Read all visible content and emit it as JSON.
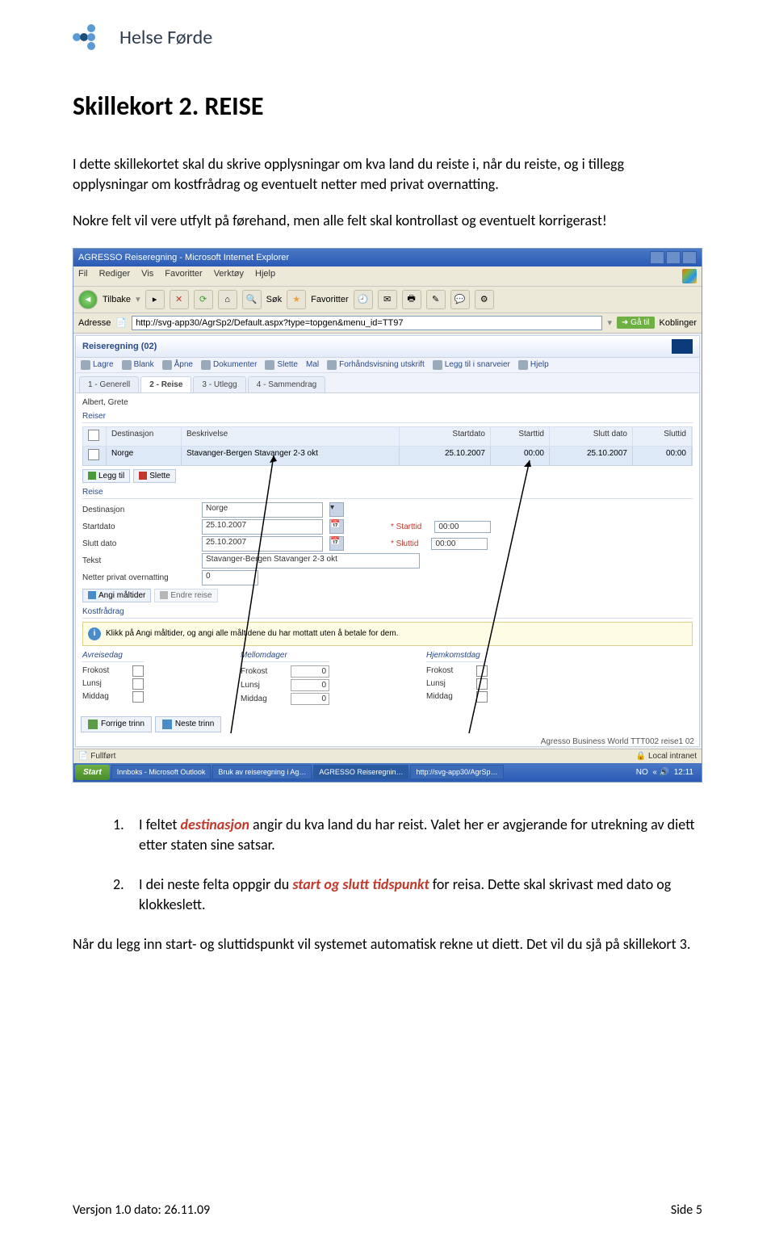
{
  "brand": "Helse Førde",
  "heading": "Skillekort 2. REISE",
  "intro1": "I dette skillekortet skal du skrive opplysningar om kva land du reiste i, når du reiste, og i tillegg opplysningar om kostfrådrag og eventuelt netter med privat overnatting.",
  "intro2": "Nokre felt vil vere utfylt på førehand, men alle felt skal kontrollast og eventuelt korrigerast!",
  "ie": {
    "title": "AGRESSO Reiseregning - Microsoft Internet Explorer",
    "menu": [
      "Fil",
      "Rediger",
      "Vis",
      "Favoritter",
      "Verktøy",
      "Hjelp"
    ],
    "back": "Tilbake",
    "search": "Søk",
    "fav": "Favoritter",
    "addr_label": "Adresse",
    "url": "http://svg-app30/AgrSp2/Default.aspx?type=topgen&menu_id=TT97",
    "go": "Gå til",
    "links": "Koblinger"
  },
  "app": {
    "title": "Reiseregning (02)",
    "toolbar": [
      "Lagre",
      "Blank",
      "Åpne",
      "Dokumenter",
      "Slette",
      "Mal",
      "Forhåndsvisning utskrift",
      "Legg til i snarveier",
      "Hjelp"
    ],
    "tabs": [
      "1 - Generell",
      "2 - Reise",
      "3 - Utlegg",
      "4 - Sammendrag"
    ],
    "person": "Albert, Grete",
    "group_reiser": "Reiser",
    "cols": {
      "dest": "Destinasjon",
      "besk": "Beskrivelse",
      "sd": "Startdato",
      "st": "Starttid",
      "sld": "Slutt dato",
      "slt": "Sluttid"
    },
    "row": {
      "dest": "Norge",
      "besk": "Stavanger-Bergen Stavanger 2-3 okt",
      "sd": "25.10.2007",
      "st": "00:00",
      "sld": "25.10.2007",
      "slt": "00:00"
    },
    "btn_add": "Legg til",
    "btn_del": "Slette",
    "group_reise": "Reise",
    "form": {
      "dest_l": "Destinasjon",
      "dest_v": "Norge",
      "sd_l": "Startdato",
      "sd_v": "25.10.2007",
      "st_l": "* Starttid",
      "st_v": "00:00",
      "sld_l": "Slutt dato",
      "sld_v": "25.10.2007",
      "slt_l": "* Sluttid",
      "slt_v": "00:00",
      "txt_l": "Tekst",
      "txt_v": "Stavanger-Bergen Stavanger 2-3 okt",
      "np_l": "Netter privat overnatting",
      "np_v": "0"
    },
    "btn_meals": "Angi måltider",
    "btn_endre": "Endre reise",
    "group_kost": "Kostfrådrag",
    "info": "Klikk på Angi måltider, og angi alle måltidene du har mottatt uten å betale for dem.",
    "meals": {
      "h1": "Avreisedag",
      "h2": "Mellomdager",
      "h3": "Hjemkomstdag",
      "frokost": "Frokost",
      "lunsj": "Lunsj",
      "middag": "Middag",
      "zero": "0"
    },
    "prev": "Forrige trinn",
    "next": "Neste trinn",
    "footline": "Agresso Business World  TTT002  reise1  02"
  },
  "status": {
    "left": "Fullført",
    "right": "Local intranet"
  },
  "taskbar": {
    "start": "Start",
    "t1": "Innboks - Microsoft Outlook",
    "t2": "Bruk av reiseregning i Ag…",
    "t3": "AGRESSO Reiseregnin…",
    "t4": "http://svg-app30/AgrSp…",
    "lang": "NO",
    "time": "12:11"
  },
  "list": {
    "n1": "1.",
    "t1a": "I feltet ",
    "t1b": "destinasjon",
    "t1c": " angir du kva land du har reist. Valet her er avgjerande for utrekning av diett etter staten sine satsar.",
    "n2": "2.",
    "t2a": "I dei neste felta oppgir du ",
    "t2b": "start og slutt tidspunkt",
    "t2c": " for reisa. Dette skal skrivast med dato og klokkeslett."
  },
  "outro": "Når du legg inn start- og sluttidspunkt vil systemet automatisk rekne ut diett. Det vil du sjå på skillekort 3.",
  "footer": {
    "left": "Versjon 1.0    dato: 26.11.09",
    "right": "Side 5"
  }
}
